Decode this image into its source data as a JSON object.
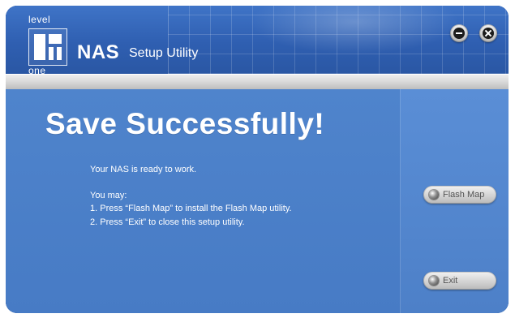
{
  "window": {
    "logo": {
      "top": "level",
      "bottom": "one"
    },
    "title": "NAS",
    "subtitle": "Setup Utility",
    "controls": {
      "minimize_icon": "minimize-icon",
      "close_icon": "close-icon"
    }
  },
  "content": {
    "headline": "Save Successfully!",
    "line1": "Your NAS is ready to work.",
    "line2": "You may:",
    "line3": "1. Press “Flash Map” to install the Flash Map utility.",
    "line4": "2. Press “Exit” to close this setup utility."
  },
  "buttons": {
    "flash_map": "Flash Map",
    "exit": "Exit"
  },
  "colors": {
    "header_blue": "#2f5fb1",
    "main_blue": "#4f84cc",
    "side_blue": "#5a8ed6"
  }
}
